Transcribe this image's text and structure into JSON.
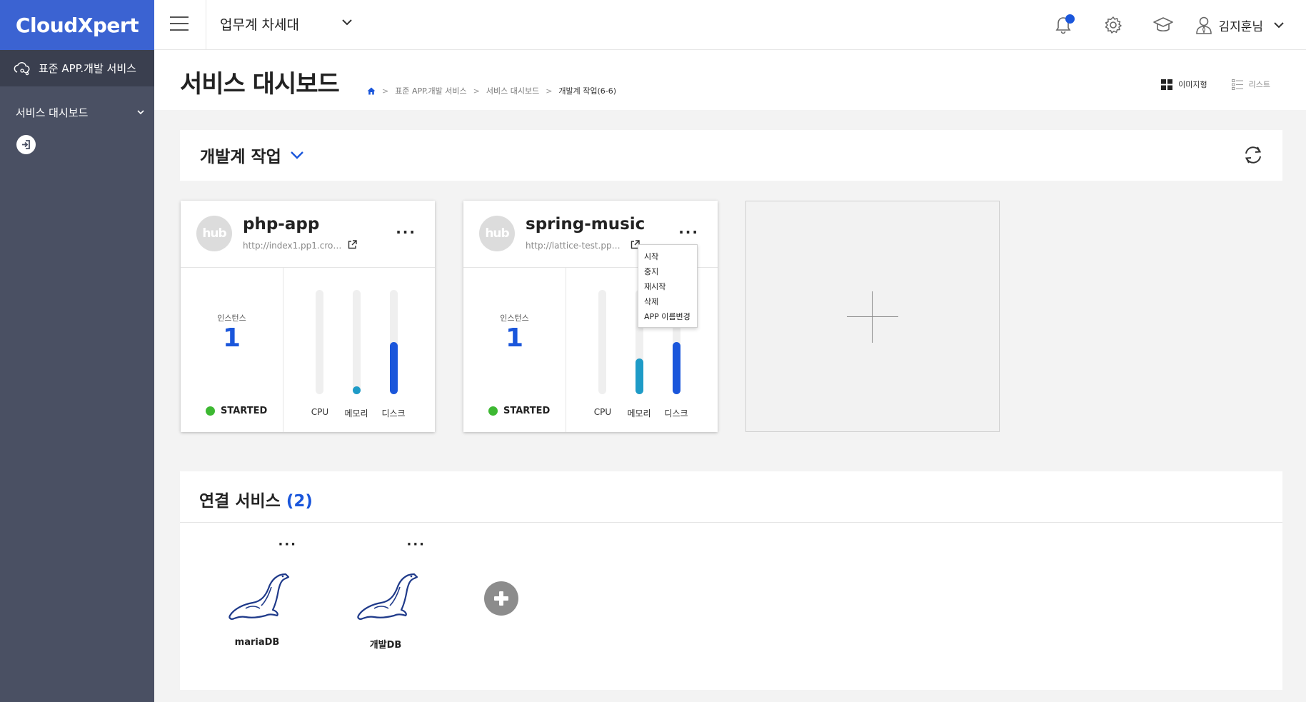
{
  "sidebar": {
    "logo": "CloudXpert",
    "service_label": "표준 APP.개발 서비스",
    "menu_label": "서비스 대시보드"
  },
  "topbar": {
    "workspace": "업무계 차세대",
    "user_name": "김지훈님"
  },
  "page": {
    "title": "서비스 대시보드",
    "breadcrumb": [
      "표준 APP.개발 서비스",
      "서비스 대시보드",
      "개발계 작업(6-6)"
    ],
    "view_image": "이미지형",
    "view_list": "리스트"
  },
  "group": {
    "title": "개발계 작업"
  },
  "apps": [
    {
      "name": "php-app",
      "url": "http://index1.pp1.crossent.com",
      "avatar": "hub",
      "instances_label": "인스턴스",
      "instances": "1",
      "status": "STARTED",
      "metrics": [
        {
          "label": "CPU",
          "value": 0
        },
        {
          "label": "메모리",
          "value": 0.05
        },
        {
          "label": "디스크",
          "value": 0.5
        }
      ]
    },
    {
      "name": "spring-music",
      "url": "http://lattice-test.pp1.crossent.com",
      "avatar": "hub",
      "instances_label": "인스턴스",
      "instances": "1",
      "status": "STARTED",
      "metrics": [
        {
          "label": "CPU",
          "value": 0
        },
        {
          "label": "메모리",
          "value": 0.34
        },
        {
          "label": "디스크",
          "value": 0.5
        }
      ]
    }
  ],
  "context_menu": [
    "시작",
    "중지",
    "재시작",
    "삭제",
    "APP 이름변경"
  ],
  "services": {
    "title": "연결 서비스",
    "count": "(2)",
    "items": [
      {
        "name": "mariaDB"
      },
      {
        "name": "개발DB"
      }
    ]
  },
  "colors": {
    "brand": "#3b63d2",
    "accent": "#1a56db",
    "memory_bar": "#1e9bc7",
    "status_ok": "#3db832"
  }
}
